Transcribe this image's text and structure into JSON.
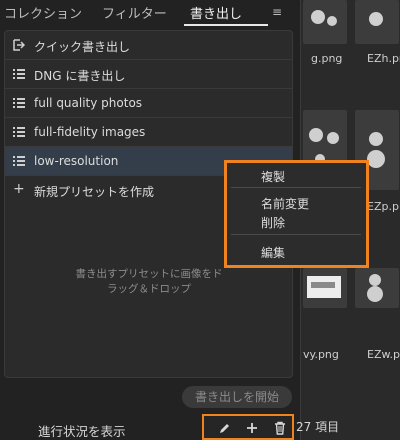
{
  "tabs": [
    {
      "label": "コレクション"
    },
    {
      "label": "フィルター"
    },
    {
      "label": "書き出し"
    }
  ],
  "tab_menu_icon": "hamburger-icon",
  "presets": [
    {
      "label": "クイック書き出し",
      "icon": "quick-export-icon"
    },
    {
      "label": "DNG に書き出し",
      "icon": "list-icon"
    },
    {
      "label": "full quality photos",
      "icon": "list-icon"
    },
    {
      "label": "full-fidelity images",
      "icon": "list-icon"
    },
    {
      "label": "low-resolution",
      "icon": "list-icon",
      "selected": true
    }
  ],
  "new_preset": {
    "label": "新規プリセットを作成",
    "icon": "plus-icon"
  },
  "drop_hint": {
    "line1": "書き出すプリセットに画像をド",
    "line2": "ラッグ＆ドロップ"
  },
  "start_export": "書き出しを開始",
  "show_progress": "進行状況を表示",
  "bottom_tools": [
    {
      "icon": "pencil-icon"
    },
    {
      "icon": "plus-icon"
    },
    {
      "icon": "trash-icon"
    }
  ],
  "context_menu": {
    "items": [
      "複製",
      "名前変更",
      "削除",
      "編集"
    ]
  },
  "grid": {
    "filenames": [
      "g.png",
      "EZh.png",
      "EZp.png",
      "vy.png",
      "EZw.png"
    ],
    "item_count": "27 項目"
  },
  "colors": {
    "highlight_border": "#f0831f",
    "selected_row": "#343e4b",
    "panel_bg": "#2b2b2b"
  }
}
